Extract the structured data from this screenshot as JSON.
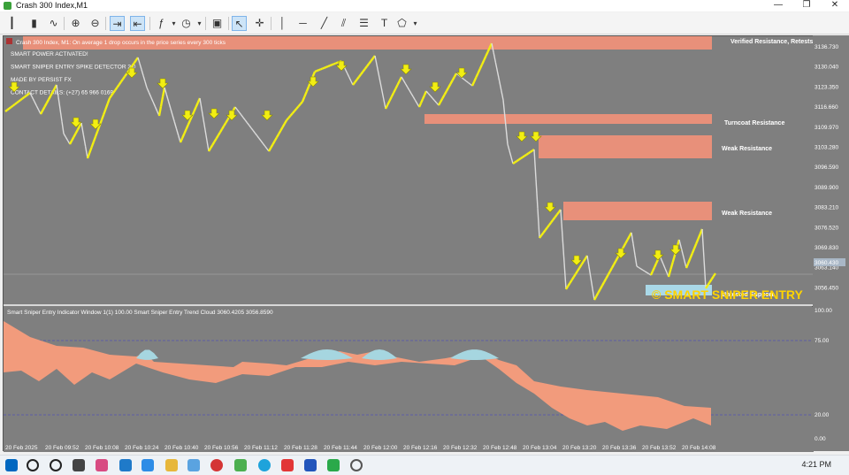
{
  "window": {
    "title": "Crash 300 Index,M1"
  },
  "chart": {
    "header": "Crash 300 Index, M1:  On average 1 drop occurs in the price series every 300 ticks",
    "overlay_lines": [
      "SMART POWER ACTIVATED!",
      "SMART SNIPER ENTRY SPIKE DETECTOR 2.0",
      "MADE BY PERSIST FX",
      "CONTACT DETAILS: (+27) 65 966 0169"
    ],
    "zones": [
      {
        "label": "Verified Resistance, Retests"
      },
      {
        "label": "Turncoat Resistance"
      },
      {
        "label": "Weak Resistance"
      },
      {
        "label": "Weak Resistance"
      },
      {
        "label": "Untested Support"
      }
    ],
    "price_ticks": [
      "3136.730",
      "3130.040",
      "3123.350",
      "3116.660",
      "3109.970",
      "3103.280",
      "3096.590",
      "3089.900",
      "3083.210",
      "3076.520",
      "3069.830",
      "3063.140",
      "3056.450"
    ],
    "current_price": "3060.430",
    "watermark": "© SMART SNIPER ENTRY"
  },
  "indicator": {
    "header": "Smart Sniper Entry Indicator Window 1(1) 100.00 Smart Sniper Entry Trend Cloud 3060.4205 3056.8590",
    "ticks": [
      "100.00",
      "75.00",
      "20.00",
      "0.00"
    ]
  },
  "time_axis": [
    "20 Feb 2025",
    "20 Feb 09:52",
    "20 Feb 10:08",
    "20 Feb 10:24",
    "20 Feb 10:40",
    "20 Feb 10:56",
    "20 Feb 11:12",
    "20 Feb 11:28",
    "20 Feb 11:44",
    "20 Feb 12:00",
    "20 Feb 12:16",
    "20 Feb 12:32",
    "20 Feb 12:48",
    "20 Feb 13:04",
    "20 Feb 13:20",
    "20 Feb 13:36",
    "20 Feb 13:52",
    "20 Feb 14:08"
  ],
  "taskbar": {
    "time": "4:21 PM"
  },
  "colors": {
    "bull": "#f2ee13",
    "bear": "#dcdcdc",
    "zone": "#e8907a",
    "support": "#a9d8e8",
    "cloud_bear": "#f29b7c",
    "cloud_bull": "#a6d6e0",
    "bg": "#7f7f7f"
  }
}
